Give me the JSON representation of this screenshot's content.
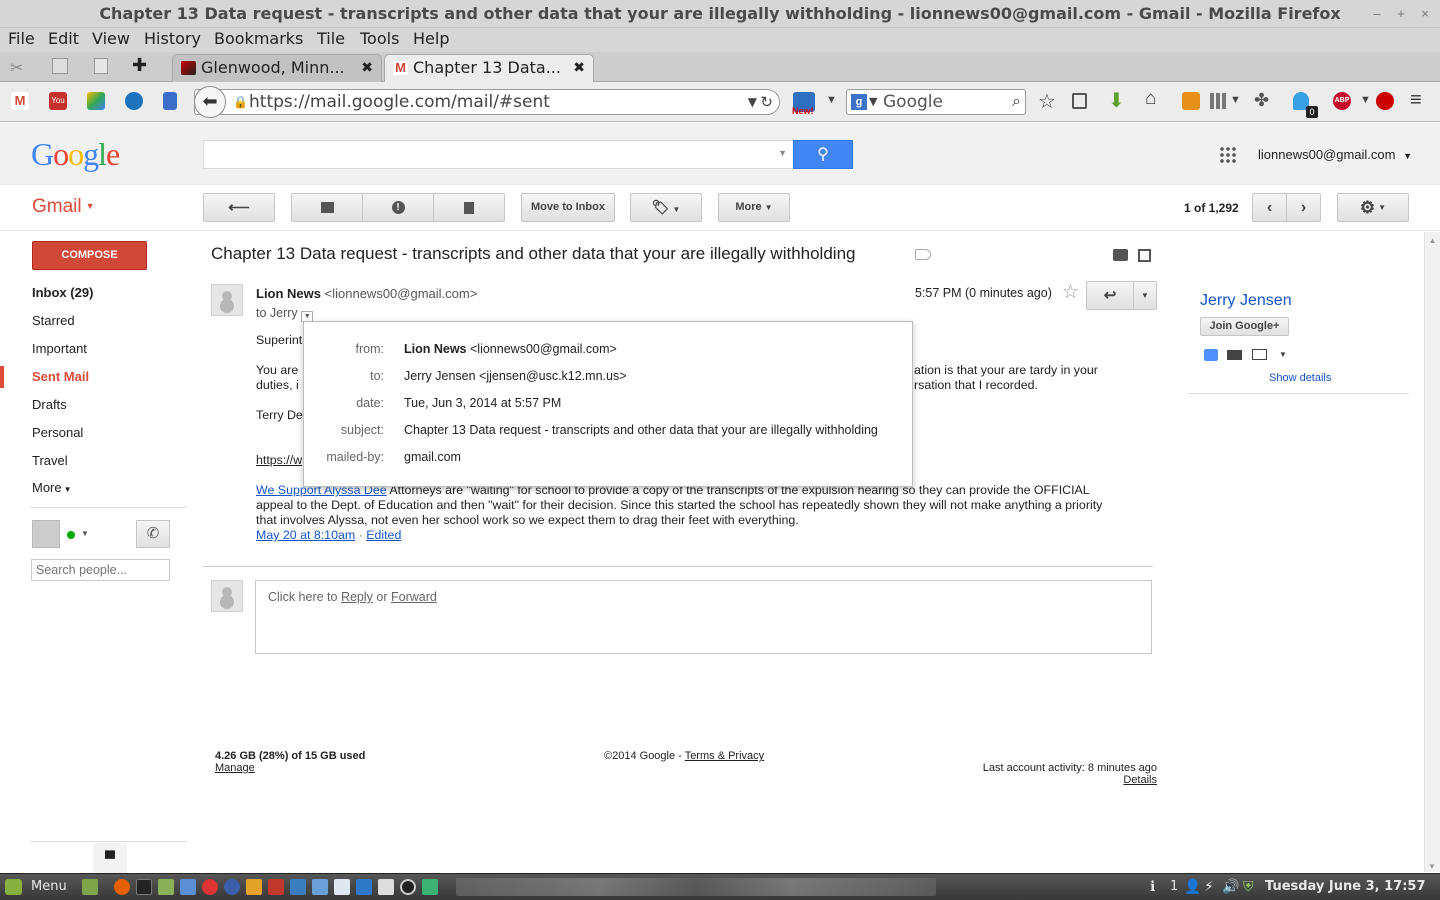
{
  "window": {
    "title": "Chapter 13 Data request - transcripts and other data that your are illegally withholding - lionnews00@gmail.com - Gmail - Mozilla Firefox",
    "controls": [
      "–",
      "+",
      "×"
    ]
  },
  "menubar": [
    "File",
    "Edit",
    "View",
    "History",
    "Bookmarks",
    "Tile",
    "Tools",
    "Help"
  ],
  "tabs": [
    {
      "label": "Glenwood, Minn...",
      "active": false
    },
    {
      "label": "Chapter 13 Data...",
      "active": true
    }
  ],
  "navbar": {
    "url": "https://mail.google.com/mail/#sent",
    "search_engine": "Google",
    "new_badge": "New!",
    "abp_count": "0"
  },
  "gmail": {
    "logo": "Google",
    "account": "lionnews00@gmail.com",
    "app_label": "Gmail",
    "toolbar": {
      "move_to_inbox": "Move to Inbox",
      "more": "More",
      "pagination": "1 of 1,292"
    },
    "compose": "COMPOSE",
    "nav": [
      {
        "label": "Inbox (29)",
        "bold": true
      },
      {
        "label": "Starred"
      },
      {
        "label": "Important"
      },
      {
        "label": "Sent Mail",
        "active": true
      },
      {
        "label": "Drafts"
      },
      {
        "label": "Personal"
      },
      {
        "label": "Travel"
      },
      {
        "label": "More"
      }
    ],
    "search_people_placeholder": "Search people...",
    "email": {
      "subject": "Chapter 13 Data request - transcripts and other data that your are illegally withholding",
      "sender_name": "Lion News",
      "sender_email": "<lionnews00@gmail.com>",
      "to": "to Jerry",
      "time": "5:57 PM (0 minutes ago)",
      "body_line1_start": "Superint",
      "body_line2_start": "You are",
      "body_line2_end": "ation is that your are tardy in your",
      "body_line3_start": "duties, i",
      "body_line3_end": "rsation that I recorded.",
      "signature_start": "Terry De",
      "link_start": "https://w",
      "quote_link": "We Support Alyssa Dee",
      "quote_text1": " Attorneys are \"waiting\" for school to provide a copy of the transcripts of the expulsion hearing so they can provide the OFFICIAL",
      "quote_text2": "appeal to the Dept. of Education and then \"wait\" for their decision. Since this started the school has repeatedly shown they will not make anything a priority",
      "quote_text3": "that involves Alyssa, not even her school work so we expect them to drag their feet with everything.",
      "quote_date": "May 20 at 8:10am",
      "quote_sep": " · ",
      "quote_edited": "Edited"
    },
    "details_popup": {
      "from_label": "from:",
      "from_name": "Lion News",
      "from_email": "<lionnews00@gmail.com>",
      "to_label": "to:",
      "to_value": "Jerry Jensen <jjensen@usc.k12.mn.us>",
      "date_label": "date:",
      "date_value": "Tue, Jun 3, 2014 at 5:57 PM",
      "subject_label": "subject:",
      "subject_value": "Chapter 13 Data request - transcripts and other data that your are illegally withholding",
      "mailed_by_label": "mailed-by:",
      "mailed_by_value": "gmail.com"
    },
    "reply_box": {
      "prefix": "Click here to ",
      "reply": "Reply",
      "or": " or ",
      "forward": "Forward"
    },
    "footer": {
      "storage": "4.26 GB (28%) of 15 GB used",
      "manage": "Manage",
      "copyright": "©2014 Google - ",
      "terms": "Terms & Privacy",
      "activity": "Last account activity: 8 minutes ago",
      "details": "Details"
    },
    "contact_panel": {
      "name": "Jerry Jensen",
      "join": "Join Google+",
      "show_details": "Show details"
    }
  },
  "taskbar": {
    "menu": "Menu",
    "tray_count": "1",
    "clock": "Tuesday June  3, 17:57"
  }
}
